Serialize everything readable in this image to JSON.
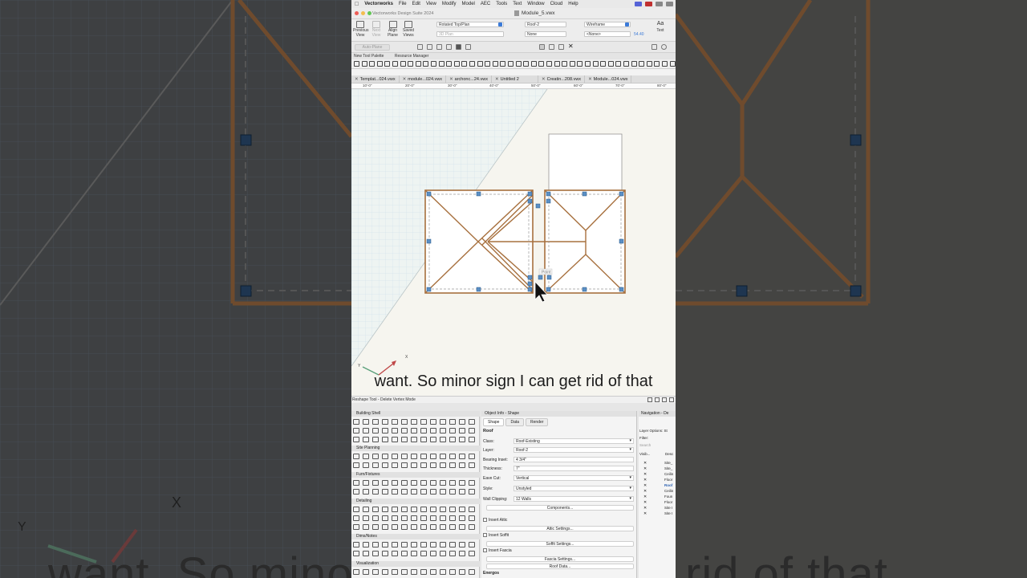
{
  "menubar": {
    "app": "Vectorworks",
    "items": [
      "File",
      "Edit",
      "View",
      "Modify",
      "Model",
      "AEC",
      "Tools",
      "Text",
      "Window",
      "Cloud",
      "Help"
    ]
  },
  "titlebar": {
    "suite": "Vectorworks Design Suite 2024",
    "document": "Module_5.vwx"
  },
  "toolbar": {
    "previous_view": "Previous View",
    "next_view": "Next View",
    "align_plane": "Align Plane",
    "saved_views": "Saved Views",
    "view_value": "Rotated Top/Plan",
    "plane_value": "3D Plan",
    "layer_value": "Roof-2",
    "class_value": "None",
    "render_value": "Wireframe",
    "extra_value": "<None>",
    "zoom_value": "54.40",
    "text_label": "Text"
  },
  "modebar": {
    "auto_plane": "Auto-Plane"
  },
  "palettes": {
    "tool_palette": "New Tool Palette",
    "resource_manager": "Resource Manager"
  },
  "tabs": [
    "Templat...024.vwx",
    "module...024.vwx",
    "archonc...24.vwx",
    "Untitled 2",
    "Creatin...208.vwx",
    "Module...024.vwx"
  ],
  "ruler": [
    "10'-0\"",
    "20'-0\"",
    "30'-0\"",
    "40'-0\"",
    "50'-0\"",
    "60'-0\"",
    "70'-0\"",
    "80'-0\""
  ],
  "canvas": {
    "snap_label": "Point",
    "axis_x": "X",
    "axis_y": "Y"
  },
  "caption": "want. So minor sign I can get rid of that",
  "statusbar": {
    "tool": "Reshape Tool",
    "mode": "Delete Vertex Mode"
  },
  "tool_sets": [
    "Building Shell",
    "Site Planning",
    "Furn/Fixtures",
    "Detailing",
    "Dims/Notes",
    "Visualization"
  ],
  "object_info": {
    "header": "Object Info - Shape",
    "tabs": [
      "Shape",
      "Data",
      "Render"
    ],
    "object": "Roof",
    "fields": [
      {
        "label": "Class:",
        "value": "Roof-Existing"
      },
      {
        "label": "Layer:",
        "value": "Roof-2"
      },
      {
        "label": "Bearing Inset:",
        "value": "4 3/4\""
      },
      {
        "label": "Thickness:",
        "value": "7\""
      },
      {
        "label": "Eave Cut:",
        "value": "Vertical"
      },
      {
        "label": "Style:",
        "value": "Unstyled"
      },
      {
        "label": "Wall Clipping:",
        "value": "12 Walls"
      }
    ],
    "components_button": "Components...",
    "insert_attic": "Insert Attic",
    "attic_button": "Attic Settings...",
    "insert_soffit": "Insert Soffit",
    "soffit_button": "Soffit Settings...",
    "insert_fascia": "Insert Fascia",
    "fascia_button": "Fascia Settings...",
    "roof_data_button": "Roof Data...",
    "energos": "Energos"
  },
  "navigation": {
    "header": "Navigation - De",
    "layer_options": "Layer Options: St",
    "filter": "Filter:",
    "search": "Search",
    "col_visible": "Visib...",
    "col_desc": "Desc",
    "layers": [
      "Site_",
      "Site_",
      "Ceilin",
      "Floor",
      "Roof",
      "Ceilin",
      "Foun",
      "Floor",
      "Site I",
      "Site I"
    ]
  },
  "background": {
    "caption": "want. So minor sign I can get rid of that",
    "x": "X",
    "y": "Y"
  }
}
